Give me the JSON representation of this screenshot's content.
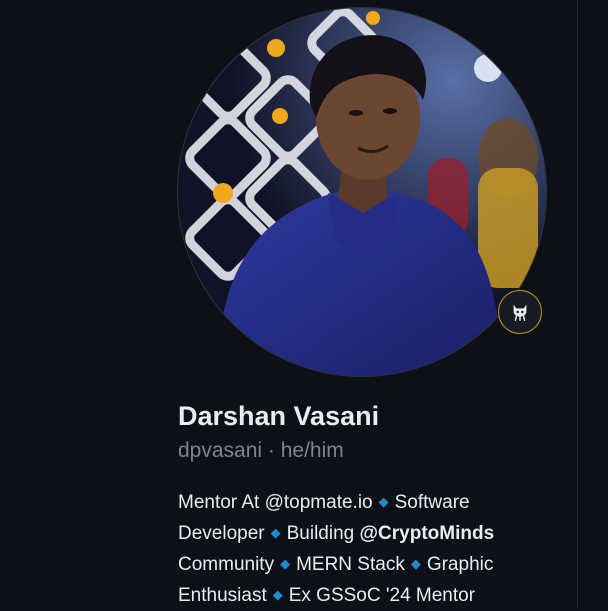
{
  "profile": {
    "name": "Darshan Vasani",
    "handle": "dpvasani",
    "separator": " · ",
    "pronouns": "he/him",
    "status_icon": "octocat-icon",
    "accent_color": "#d29922",
    "bio_diamond_color": "#1f8ad2"
  },
  "bio": {
    "diamond": "◆",
    "line1_a": "Mentor At @topmate.io",
    "line1_b": "Software",
    "line2_a": "Developer",
    "line2_b": "Building",
    "line2_org": "@CryptoMinds",
    "line3_a": "Community",
    "line3_b": "MERN Stack",
    "line3_c": "Graphic",
    "line4_a": "Enthusiast",
    "line4_b": "Ex GSSoC '24 Mentor"
  }
}
